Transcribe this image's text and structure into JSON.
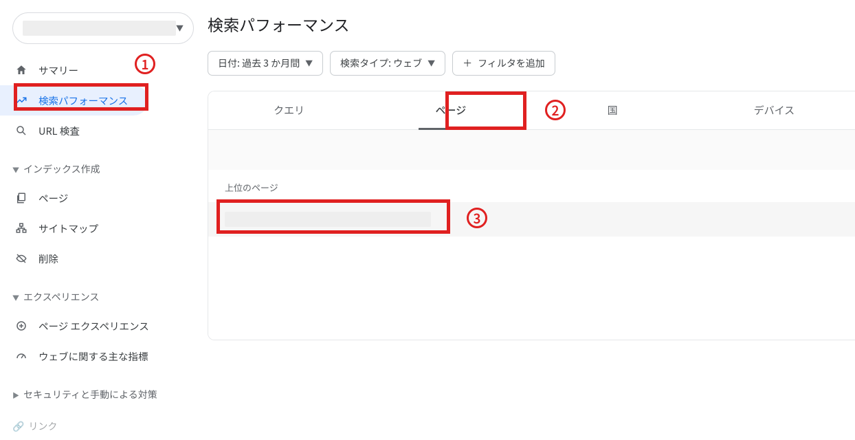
{
  "sidebar": {
    "nav": {
      "summary": "サマリー",
      "performance": "検索パフォーマンス",
      "url_inspect": "URL 検査"
    },
    "section_index": "インデックス作成",
    "index": {
      "pages": "ページ",
      "sitemaps": "サイトマップ",
      "removals": "削除"
    },
    "section_experience": "エクスペリエンス",
    "experience": {
      "page_exp": "ページ エクスペリエンス",
      "cwv": "ウェブに関する主な指標"
    },
    "section_security": "セキュリティと手動による対策",
    "section_links": "リンク"
  },
  "main": {
    "title": "検索パフォーマンス",
    "filter_date": "日付: 過去 3 か月間",
    "filter_type": "検索タイプ: ウェブ",
    "filter_add": "フィルタを追加",
    "tabs": {
      "query": "クエリ",
      "page": "ページ",
      "country": "国",
      "device": "デバイス"
    },
    "table_header": "上位のページ"
  },
  "annotations": {
    "one": "1",
    "two": "2",
    "three": "3"
  }
}
